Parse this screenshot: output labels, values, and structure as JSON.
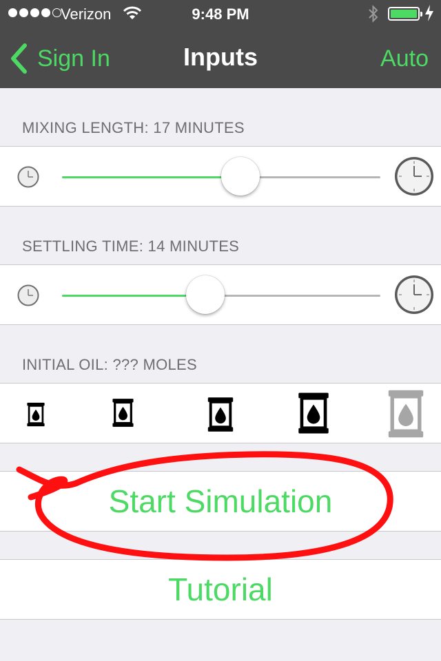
{
  "status_bar": {
    "carrier": "Verizon",
    "time": "9:48 PM",
    "signal_bars": 4,
    "signal_total": 5,
    "battery_level": 1.0
  },
  "nav": {
    "back_label": "Sign In",
    "title": "Inputs",
    "right_label": "Auto"
  },
  "mixing": {
    "header": "MIXING LENGTH: 17 MINUTES",
    "slider_value": 0.56
  },
  "settling": {
    "header": "SETTLING TIME: 14 MINUTES",
    "slider_value": 0.45
  },
  "oil": {
    "header": "INITIAL OIL: ??? MOLES",
    "options": [
      "barrel-size-1",
      "barrel-size-2",
      "barrel-size-3",
      "barrel-size-4",
      "barrel-size-5"
    ]
  },
  "buttons": {
    "start": "Start Simulation",
    "tutorial": "Tutorial"
  },
  "colors": {
    "accent": "#4cd964",
    "navbar": "#4a4a4a",
    "annotation": "#ff0000"
  }
}
